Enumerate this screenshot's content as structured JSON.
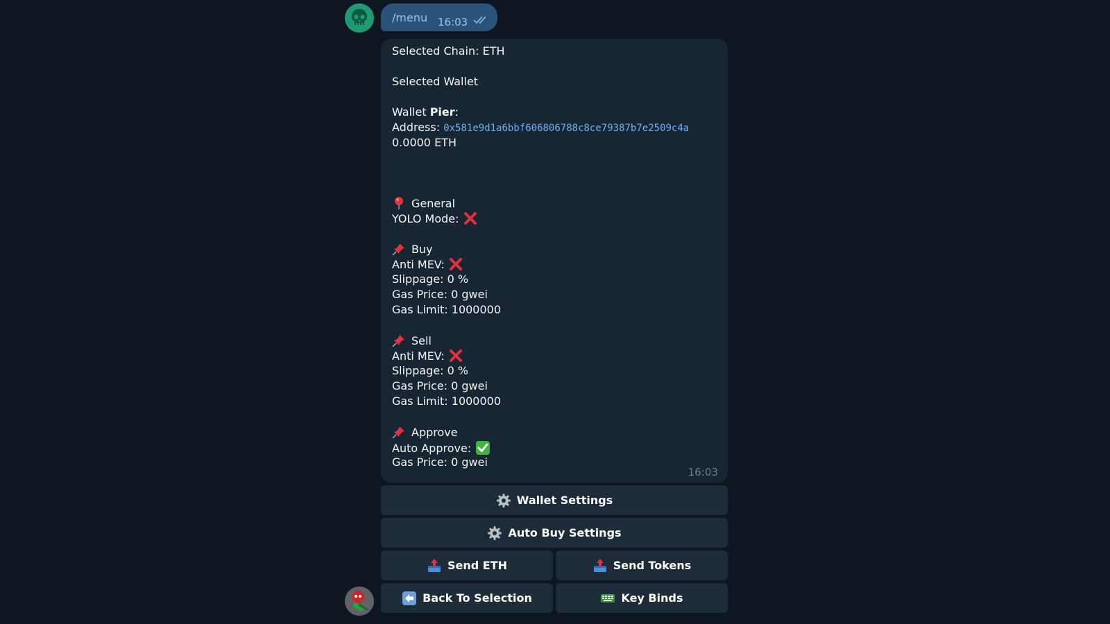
{
  "outgoing": {
    "text": "/menu",
    "time": "16:03"
  },
  "message": {
    "selected_chain": "Selected Chain: ETH",
    "selected_wallet": "Selected Wallet",
    "wallet_label": "Wallet ",
    "wallet_name": "Pier",
    "wallet_colon": ":",
    "address_label": "Address: ",
    "address_value": "0x581e9d1a6bbf606806788c8ce79387b7e2509c4a",
    "balance": "0.0000 ETH",
    "general": {
      "heading": "General",
      "yolo_label": "YOLO Mode:"
    },
    "buy": {
      "heading": "Buy",
      "anti_mev_label": "Anti MEV:",
      "slippage": "Slippage: 0 %",
      "gas_price": "Gas Price: 0 gwei",
      "gas_limit": "Gas Limit: 1000000"
    },
    "sell": {
      "heading": "Sell",
      "anti_mev_label": "Anti MEV:",
      "slippage": "Slippage: 0 %",
      "gas_price": "Gas Price: 0 gwei",
      "gas_limit": "Gas Limit: 1000000"
    },
    "approve": {
      "heading": "Approve",
      "auto_approve_label": "Auto Approve:",
      "gas_price": "Gas Price: 0 gwei"
    },
    "time": "16:03"
  },
  "keyboard": {
    "wallet_settings": "Wallet Settings",
    "auto_buy_settings": "Auto Buy Settings",
    "send_eth": "Send ETH",
    "send_tokens": "Send Tokens",
    "back_to_selection": "Back To Selection",
    "key_binds": "Key Binds"
  },
  "colors": {
    "background": "#0e1621",
    "message_bubble": "#182533",
    "outgoing_bubble": "#2b5278",
    "keyboard_button": "#1e2c3a",
    "link": "#6ab3f3"
  }
}
